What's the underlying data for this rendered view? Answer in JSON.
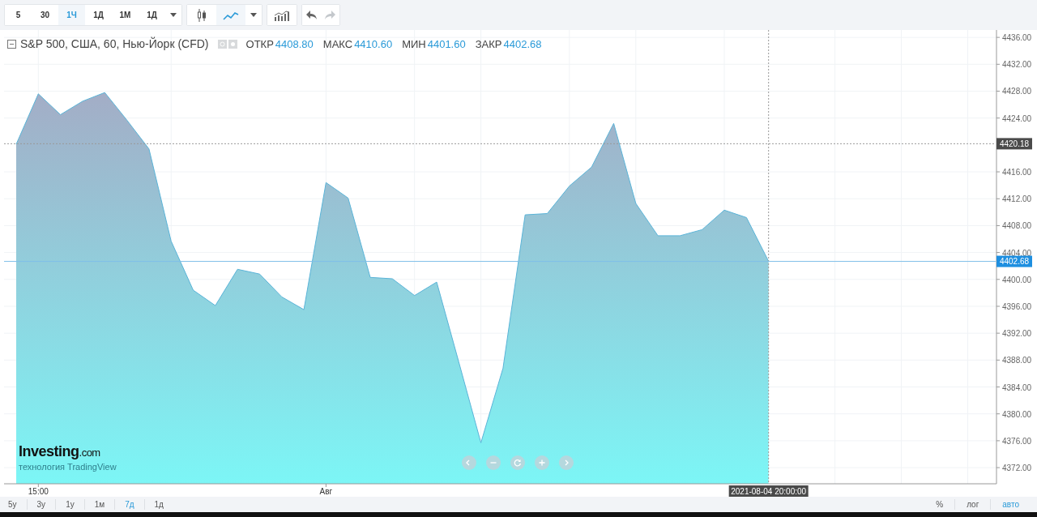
{
  "toolbar": {
    "intervals": [
      {
        "label": "5",
        "selected": false
      },
      {
        "label": "30",
        "selected": false
      },
      {
        "label": "1Ч",
        "selected": true
      },
      {
        "label": "1Д",
        "selected": false
      },
      {
        "label": "1М",
        "selected": false
      },
      {
        "label": "1Д",
        "selected": false
      }
    ],
    "chart_types": [
      {
        "kind": "candles",
        "selected": false
      },
      {
        "kind": "line",
        "selected": true
      }
    ],
    "history": [
      {
        "kind": "undo",
        "disabled": false
      },
      {
        "kind": "redo",
        "disabled": true
      }
    ]
  },
  "legend": {
    "title": "S&P 500, США, 60, Нью-Йорк (CFD)",
    "values": [
      {
        "label": "ОТКР",
        "value": "4408.80"
      },
      {
        "label": "МАКС",
        "value": "4410.60"
      },
      {
        "label": "МИН",
        "value": "4401.60"
      },
      {
        "label": "ЗАКР",
        "value": "4402.68"
      }
    ]
  },
  "watermark_logo": {
    "brand": "Investing",
    "suffix": ".com",
    "caption": "технология TradingView"
  },
  "chart": {
    "chart_data": {
      "type": "area",
      "categories": [
        null,
        "15:00",
        null,
        null,
        null,
        null,
        null,
        null,
        null,
        null,
        null,
        null,
        null,
        null,
        "Авг",
        null,
        null,
        null,
        null,
        null,
        null,
        null,
        null,
        null,
        null,
        null,
        null,
        null,
        null,
        null,
        null,
        null,
        null,
        null,
        null
      ],
      "series": [
        {
          "color": "#5ab4d8",
          "values": [
            4420.1,
            4427.6,
            4424.5,
            4426.5,
            4427.8,
            4423.7,
            4419.4,
            4405.7,
            4398.4,
            4396.1,
            4401.5,
            4400.8,
            4397.4,
            4395.5,
            4414.4,
            4412.1,
            4400.3,
            4400.1,
            4397.6,
            4399.6,
            4387.7,
            4375.7,
            4386.8,
            4409.6,
            4409.8,
            4413.9,
            4416.7,
            4423.2,
            4411.3,
            4406.5,
            4406.5,
            4407.4,
            4410.3,
            4409.2,
            4402.7
          ]
        }
      ],
      "ylim": [
        4369.6,
        4437.1
      ],
      "grid": true,
      "yticks": [
        {
          "value": 4436,
          "label": "4436.00"
        },
        {
          "value": 4432,
          "label": "4432.00"
        },
        {
          "value": 4428,
          "label": "4428.00"
        },
        {
          "value": 4424,
          "label": "4424.00"
        },
        {
          "value": 4416,
          "label": "4416.00"
        },
        {
          "value": 4412,
          "label": "4412.00"
        },
        {
          "value": 4408,
          "label": "4408.00"
        },
        {
          "value": 4404,
          "label": "4404.00"
        },
        {
          "value": 4400,
          "label": "4400.00"
        },
        {
          "value": 4396,
          "label": "4396.00"
        },
        {
          "value": 4392,
          "label": "4392.00"
        },
        {
          "value": 4388,
          "label": "4388.00"
        },
        {
          "value": 4384,
          "label": "4384.00"
        },
        {
          "value": 4380,
          "label": "4380.00"
        },
        {
          "value": 4376,
          "label": "4376.00"
        },
        {
          "value": 4372,
          "label": "4372.00"
        }
      ]
    },
    "crosshair": {
      "price": "4420.18",
      "time": "2021-08-04 20:00:00"
    },
    "last_price": {
      "label": "4402.68"
    }
  },
  "ranges": [
    {
      "label": "5у",
      "selected": false
    },
    {
      "label": "3у",
      "selected": false
    },
    {
      "label": "1у",
      "selected": false
    },
    {
      "label": "1м",
      "selected": false
    },
    {
      "label": "7д",
      "selected": true
    },
    {
      "label": "1д",
      "selected": false
    }
  ],
  "scale_modes": [
    {
      "label": "%",
      "selected": false
    },
    {
      "label": "лог",
      "selected": false
    },
    {
      "label": "авто",
      "selected": true
    }
  ]
}
